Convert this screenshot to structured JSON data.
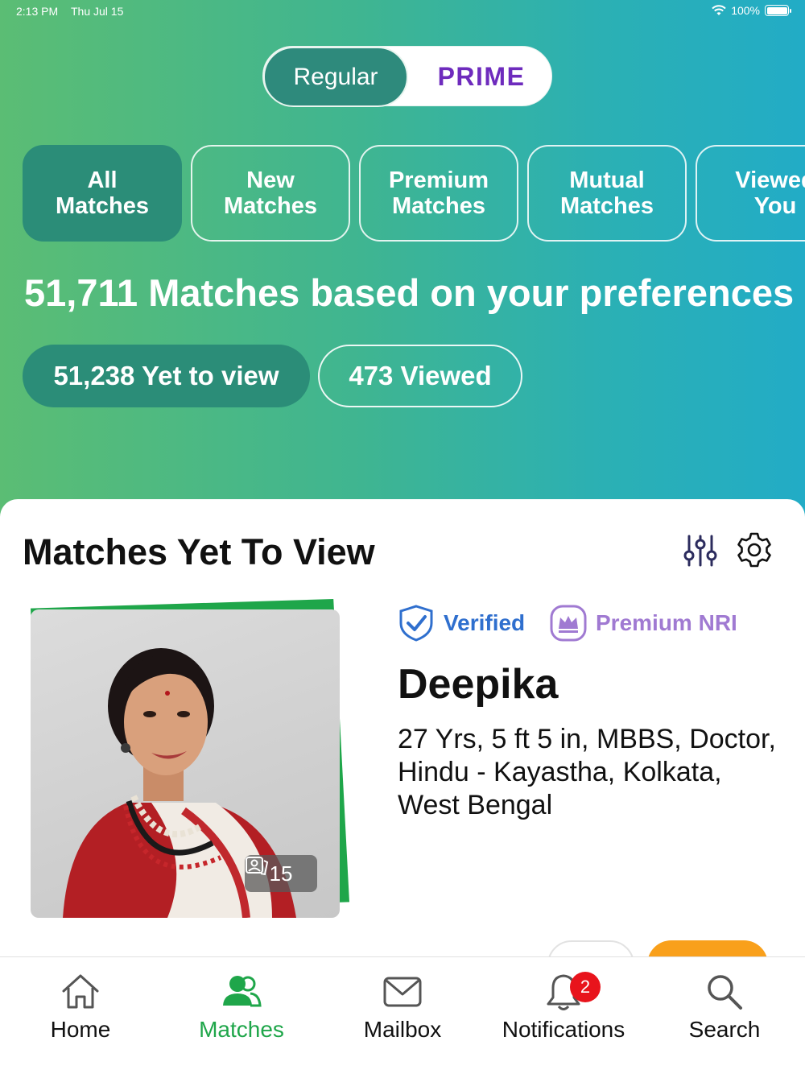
{
  "status_bar": {
    "time": "2:13 PM",
    "date": "Thu Jul 15",
    "battery": "100%"
  },
  "plan_switch": {
    "regular": "Regular",
    "prime": "PRIME"
  },
  "tabs": [
    {
      "line1": "All",
      "line2": "Matches"
    },
    {
      "line1": "New",
      "line2": "Matches"
    },
    {
      "line1": "Premium",
      "line2": "Matches"
    },
    {
      "line1": "Mutual",
      "line2": "Matches"
    },
    {
      "line1": "Viewed",
      "line2": "You"
    }
  ],
  "matches_summary": "51,711 Matches based on your preferences",
  "pills": {
    "yet_to_view": "51,238 Yet to view",
    "viewed": "473 Viewed"
  },
  "card": {
    "title": "Matches Yet To View",
    "photo_count": "15",
    "badges": {
      "verified": "Verified",
      "premium": "Premium NRI"
    },
    "name": "Deepika",
    "details": "27 Yrs, 5 ft 5 in, MBBS, Doctor, Hindu - Kayastha, Kolkata, West Bengal"
  },
  "bottom_nav": {
    "home": "Home",
    "matches": "Matches",
    "mailbox": "Mailbox",
    "notifications": "Notifications",
    "notifications_count": "2",
    "search": "Search"
  },
  "colors": {
    "accent_green": "#1fa64a",
    "tab_active": "#2b8d78",
    "prime_purple": "#6e2bbd",
    "verified_blue": "#2f6fce",
    "premium_purple": "#a07ad2",
    "badge_red": "#e8141c"
  }
}
